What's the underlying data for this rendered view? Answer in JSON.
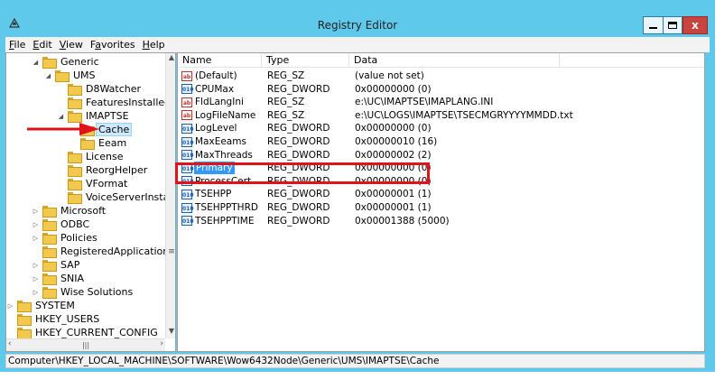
{
  "window": {
    "title": "Registry Editor",
    "close_glyph": "x",
    "accent_color": "#5fc9ec",
    "annotation_color": "#e0121a"
  },
  "menu": [
    {
      "underline": "F",
      "rest": "ile"
    },
    {
      "underline": "E",
      "rest": "dit"
    },
    {
      "underline": "V",
      "rest": "iew"
    },
    {
      "pre": "F",
      "underline": "a",
      "rest": "vorites"
    },
    {
      "underline": "H",
      "rest": "elp"
    }
  ],
  "tree": [
    {
      "label": "Generic",
      "level": 2,
      "expander": "open"
    },
    {
      "label": "UMS",
      "level": 3,
      "expander": "open"
    },
    {
      "label": "D8Watcher",
      "level": 4,
      "expander": "none"
    },
    {
      "label": "FeaturesInstalled",
      "level": 4,
      "expander": "none"
    },
    {
      "label": "IMAPTSE",
      "level": 4,
      "expander": "open"
    },
    {
      "label": "Cache",
      "level": 5,
      "expander": "none",
      "selected": true
    },
    {
      "label": "Eeam",
      "level": 5,
      "expander": "none"
    },
    {
      "label": "License",
      "level": 4,
      "expander": "none"
    },
    {
      "label": "ReorgHelper",
      "level": 4,
      "expander": "none"
    },
    {
      "label": "VFormat",
      "level": 4,
      "expander": "none"
    },
    {
      "label": "VoiceServerInstall",
      "level": 4,
      "expander": "none"
    },
    {
      "label": "Microsoft",
      "level": 2,
      "expander": "closed"
    },
    {
      "label": "ODBC",
      "level": 2,
      "expander": "closed"
    },
    {
      "label": "Policies",
      "level": 2,
      "expander": "closed"
    },
    {
      "label": "RegisteredApplications",
      "level": 2,
      "expander": "none"
    },
    {
      "label": "SAP",
      "level": 2,
      "expander": "closed"
    },
    {
      "label": "SNIA",
      "level": 2,
      "expander": "closed"
    },
    {
      "label": "Wise Solutions",
      "level": 2,
      "expander": "closed"
    },
    {
      "label": "SYSTEM",
      "level": 0,
      "expander": "closed"
    },
    {
      "label": "HKEY_USERS",
      "level": 0,
      "expander": "none"
    },
    {
      "label": "HKEY_CURRENT_CONFIG",
      "level": 0,
      "expander": "none"
    }
  ],
  "columns": {
    "name": "Name",
    "type": "Type",
    "data": "Data"
  },
  "values": [
    {
      "name": "(Default)",
      "type": "REG_SZ",
      "data": "(value not set)",
      "kind": "sz"
    },
    {
      "name": "CPUMax",
      "type": "REG_DWORD",
      "data": "0x00000000 (0)",
      "kind": "dword"
    },
    {
      "name": "FldLangIni",
      "type": "REG_SZ",
      "data": "e:\\UC\\IMAPTSE\\IMAPLANG.INI",
      "kind": "sz"
    },
    {
      "name": "LogFileName",
      "type": "REG_SZ",
      "data": "e:\\UC\\LOGS\\IMAPTSE\\TSECMGRYYYYMMDD.txt",
      "kind": "sz"
    },
    {
      "name": "LogLevel",
      "type": "REG_DWORD",
      "data": "0x00000000 (0)",
      "kind": "dword"
    },
    {
      "name": "MaxEeams",
      "type": "REG_DWORD",
      "data": "0x00000010 (16)",
      "kind": "dword"
    },
    {
      "name": "MaxThreads",
      "type": "REG_DWORD",
      "data": "0x00000002 (2)",
      "kind": "dword"
    },
    {
      "name": "Primary",
      "type": "REG_DWORD",
      "data": "0x00000000 (0)",
      "kind": "dword",
      "selected": true
    },
    {
      "name": "ProcessCert",
      "type": "REG_DWORD",
      "data": "0x00000000 (0)",
      "kind": "dword"
    },
    {
      "name": "TSEHPP",
      "type": "REG_DWORD",
      "data": "0x00000001 (1)",
      "kind": "dword"
    },
    {
      "name": "TSEHPPTHRD",
      "type": "REG_DWORD",
      "data": "0x00000001 (1)",
      "kind": "dword"
    },
    {
      "name": "TSEHPPTIME",
      "type": "REG_DWORD",
      "data": "0x00001388 (5000)",
      "kind": "dword"
    }
  ],
  "icons": {
    "string_value": "ab",
    "dword_value": "010"
  },
  "status_path": "Computer\\HKEY_LOCAL_MACHINE\\SOFTWARE\\Wow6432Node\\Generic\\UMS\\IMAPTSE\\Cache"
}
